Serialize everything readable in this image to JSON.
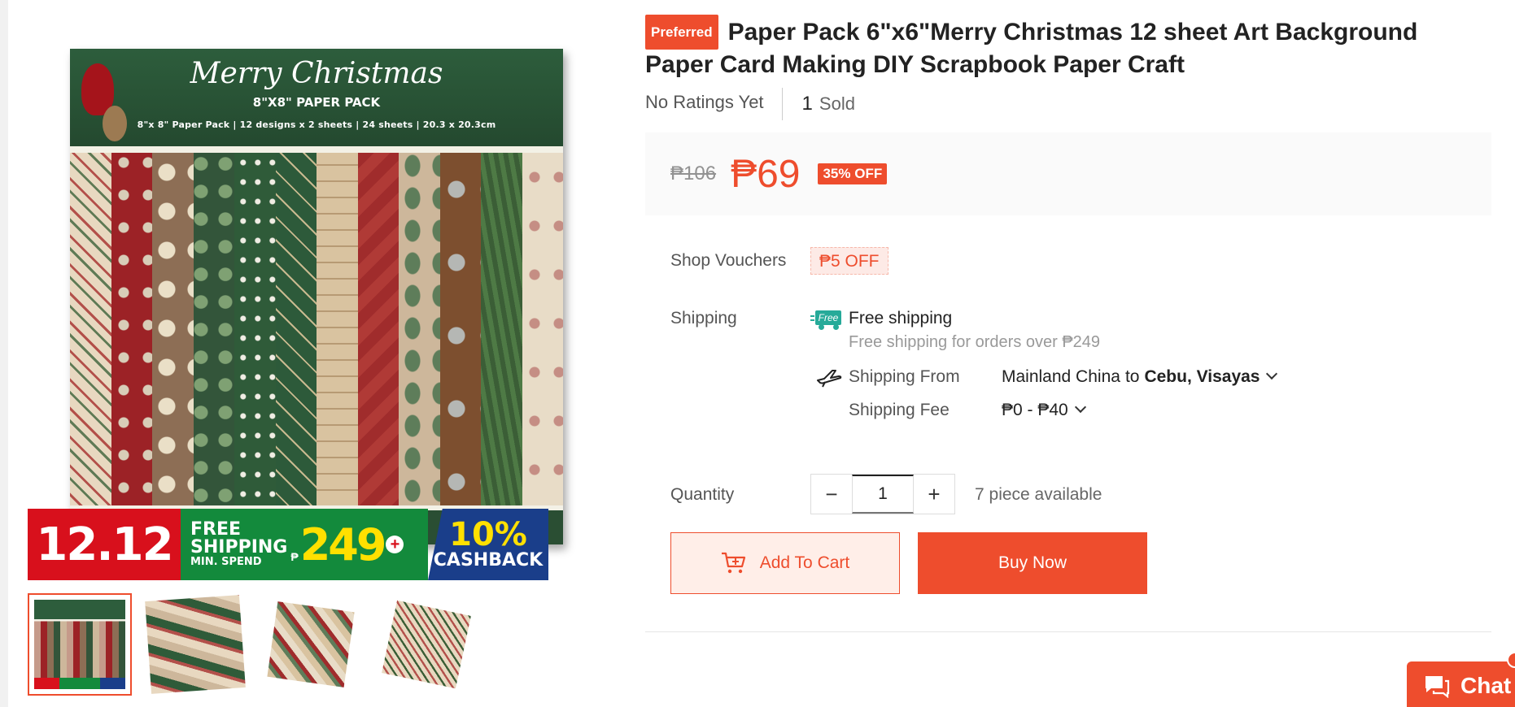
{
  "gallery": {
    "main_image": {
      "cover_title": "Merry Christmas",
      "cover_subtitle": "8\"X8\" PAPER PACK",
      "cover_specs": "8\"x 8\" Paper Pack   |   12 designs x 2 sheets   |   24 sheets   |   20.3 x 20.3cm"
    },
    "promo_banner": {
      "date": "12.12",
      "free_line1": "FREE",
      "free_line2": "SHIPPING",
      "min_spend": "MIN. SPEND",
      "currency": "₱",
      "amount": "249",
      "plus": "+",
      "cashback_pct": "10%",
      "cashback_label": "CASHBACK"
    },
    "thumbnails": 4
  },
  "product": {
    "badge": "Preferred",
    "title": "Paper Pack 6\"x6\"Merry Christmas 12 sheet Art Background Paper Card Making DIY Scrapbook Paper Craft",
    "ratings": "No Ratings Yet",
    "sold_count": "1",
    "sold_label": "Sold"
  },
  "price": {
    "original": "₱106",
    "current": "₱69",
    "discount": "35% OFF"
  },
  "vouchers": {
    "label": "Shop Vouchers",
    "chip": "₱5 OFF"
  },
  "shipping": {
    "label": "Shipping",
    "free_icon_text": "Free",
    "free_title": "Free shipping",
    "free_note": "Free shipping for orders over ₱249",
    "from_label": "Shipping From",
    "from_origin": "Mainland China",
    "to_word": "to",
    "destination": "Cebu, Visayas",
    "fee_label": "Shipping Fee",
    "fee_value": "₱0 - ₱40"
  },
  "quantity": {
    "label": "Quantity",
    "minus": "−",
    "value": "1",
    "plus": "+",
    "stock": "7 piece available"
  },
  "actions": {
    "add_to_cart": "Add To Cart",
    "buy_now": "Buy Now"
  },
  "chat": {
    "label": "Chat"
  },
  "colors": {
    "accent": "#ee4d2d",
    "free_shipping": "#26aa99",
    "promo_red": "#d8101c",
    "promo_green": "#138a3c",
    "promo_blue": "#1a3e8a",
    "promo_yellow": "#ffe000"
  }
}
